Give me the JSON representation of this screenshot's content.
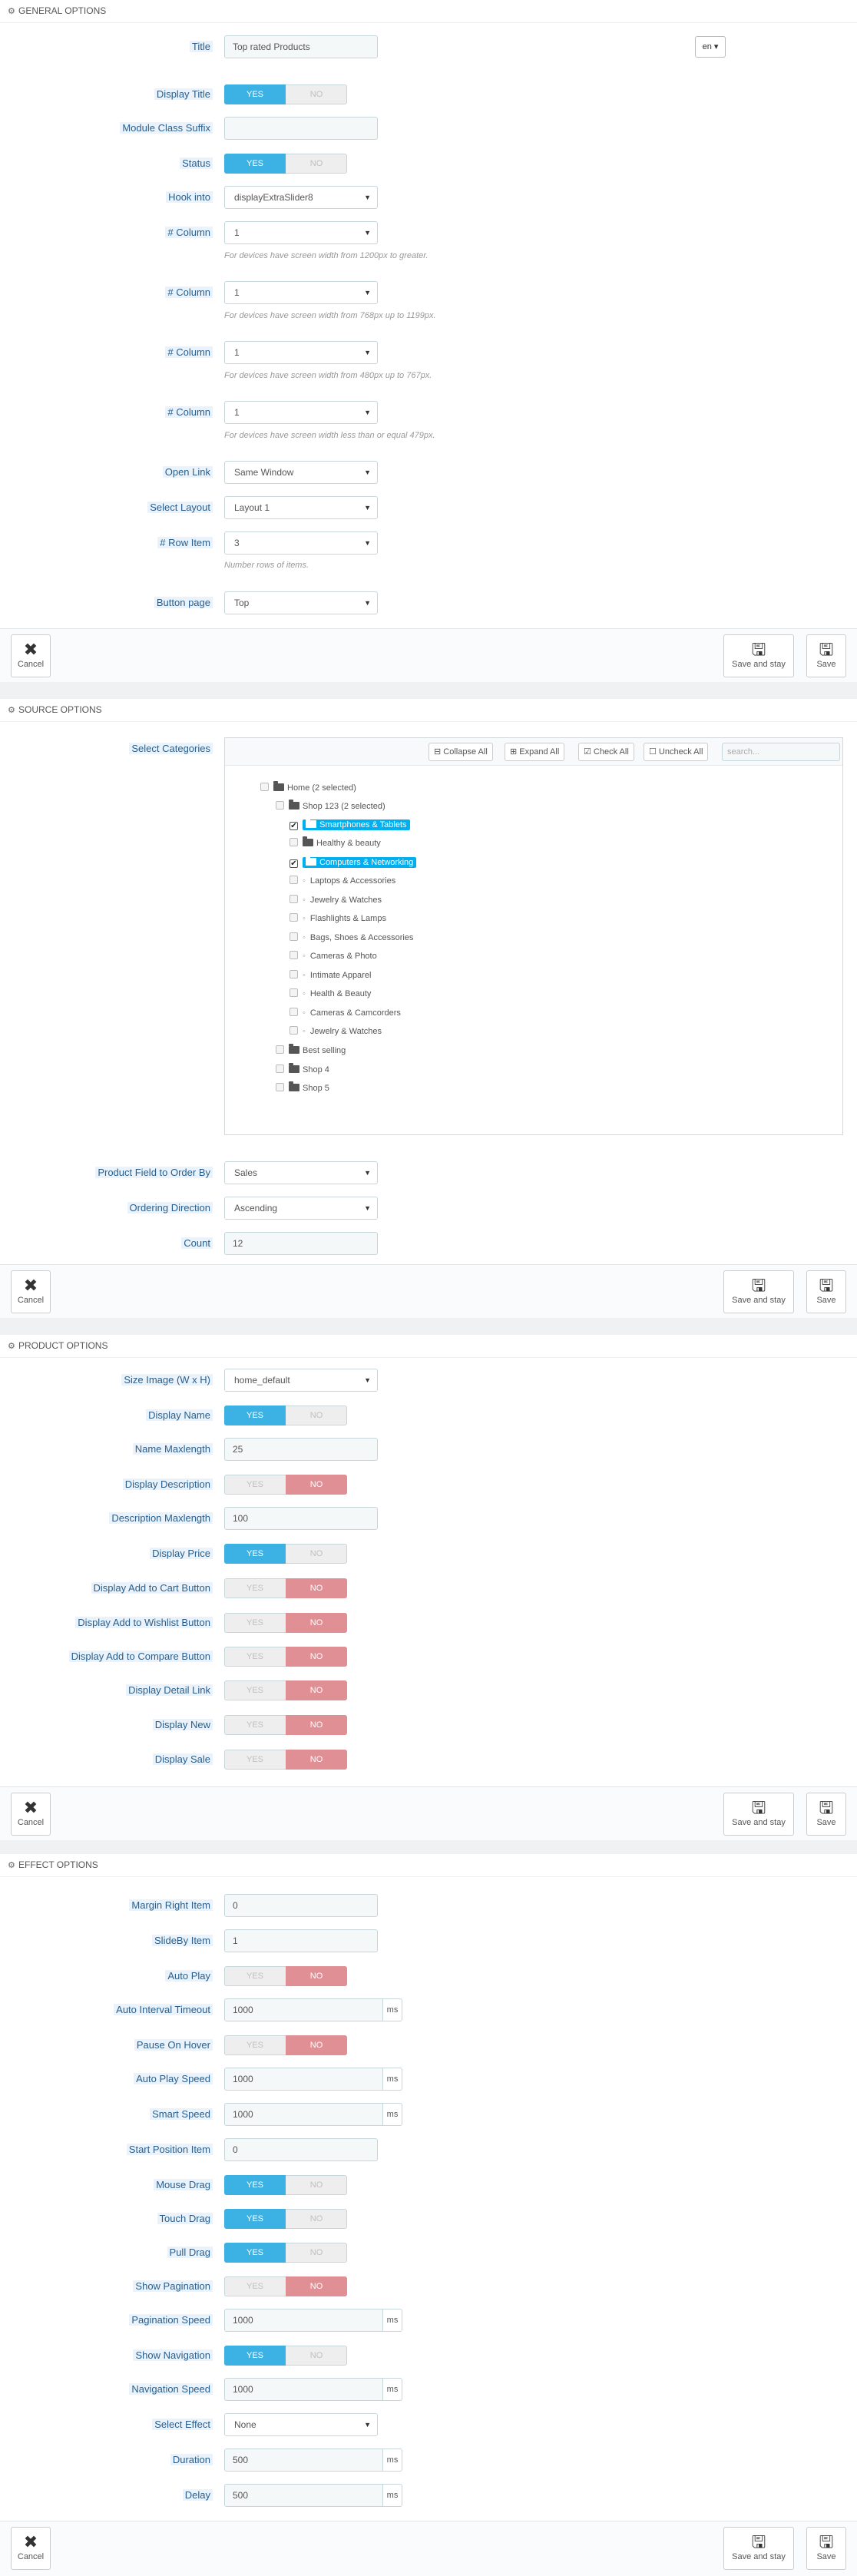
{
  "general": {
    "title": "GENERAL OPTIONS",
    "fields": {
      "title_label": "Title",
      "title_value": "Top rated Products",
      "lang": "en",
      "display_title_label": "Display Title",
      "suffix_label": "Module Class Suffix",
      "status_label": "Status",
      "hook_label": "Hook into",
      "hook_value": "displayExtraSlider8",
      "col1_label": "# Column",
      "col1_value": "1",
      "col1_help": "For devices have screen width from 1200px to greater.",
      "col2_label": "# Column",
      "col2_value": "1",
      "col2_help": "For devices have screen width from 768px up to 1199px.",
      "col3_label": "# Column",
      "col3_value": "1",
      "col3_help": "For devices have screen width from 480px up to 767px.",
      "col4_label": "# Column",
      "col4_value": "1",
      "col4_help": "For devices have screen width less than or equal 479px.",
      "open_link_label": "Open Link",
      "open_link_value": "Same Window",
      "layout_label": "Select Layout",
      "layout_value": "Layout 1",
      "row_item_label": "# Row Item",
      "row_item_value": "3",
      "row_item_help": "Number rows of items.",
      "button_page_label": "Button page",
      "button_page_value": "Top"
    }
  },
  "source": {
    "title": "SOURCE OPTIONS",
    "select_categories_label": "Select Categories",
    "tools": {
      "collapse": "Collapse All",
      "expand": "Expand All",
      "check": "Check All",
      "uncheck": "Uncheck All",
      "search_placeholder": "search..."
    },
    "tree": {
      "home": "Home (2 selected)",
      "shop123": "Shop 123 (2 selected)",
      "smartphones": "Smartphones & Tablets",
      "healthy": "Healthy & beauty",
      "computers": "Computers & Networking",
      "laptops": "Laptops & Accessories",
      "jewelry1": "Jewelry & Watches",
      "flashlights": "Flashlights & Lamps",
      "bags": "Bags, Shoes & Accessories",
      "cameras_photo": "Cameras & Photo",
      "intimate": "Intimate Apparel",
      "health": "Health & Beauty",
      "camcorders": "Cameras & Camcorders",
      "jewelry2": "Jewelry & Watches",
      "best": "Best selling",
      "shop4": "Shop 4",
      "shop5": "Shop 5"
    },
    "order_by_label": "Product Field to Order By",
    "order_by_value": "Sales",
    "direction_label": "Ordering Direction",
    "direction_value": "Ascending",
    "count_label": "Count",
    "count_value": "12"
  },
  "product": {
    "title": "PRODUCT OPTIONS",
    "size_label": "Size Image (W x H)",
    "size_value": "home_default",
    "display_name_label": "Display Name",
    "name_max_label": "Name Maxlength",
    "name_max_value": "25",
    "display_desc_label": "Display Description",
    "desc_max_label": "Description Maxlength",
    "desc_max_value": "100",
    "display_price_label": "Display Price",
    "cart_label": "Display Add to Cart Button",
    "wishlist_label": "Display Add to Wishlist Button",
    "compare_label": "Display Add to Compare Button",
    "detail_label": "Display Detail Link",
    "new_label": "Display New",
    "sale_label": "Display Sale"
  },
  "effect": {
    "title": "EFFECT OPTIONS",
    "margin_label": "Margin Right Item",
    "margin_value": "0",
    "slideby_label": "SlideBy Item",
    "slideby_value": "1",
    "autoplay_label": "Auto Play",
    "interval_label": "Auto Interval Timeout",
    "interval_value": "1000",
    "pause_label": "Pause On Hover",
    "autospeed_label": "Auto Play Speed",
    "autospeed_value": "1000",
    "smart_label": "Smart Speed",
    "smart_value": "1000",
    "start_label": "Start Position Item",
    "start_value": "0",
    "mouse_label": "Mouse Drag",
    "touch_label": "Touch Drag",
    "pull_label": "Pull Drag",
    "showpag_label": "Show Pagination",
    "pagspeed_label": "Pagination Speed",
    "pagspeed_value": "1000",
    "shownav_label": "Show Navigation",
    "navspeed_label": "Navigation Speed",
    "navspeed_value": "1000",
    "effect_label": "Select Effect",
    "effect_value": "None",
    "duration_label": "Duration",
    "duration_value": "500",
    "delay_label": "Delay",
    "delay_value": "500"
  },
  "common": {
    "yes": "YES",
    "no": "NO",
    "ms": "ms",
    "cancel": "Cancel",
    "save_stay": "Save and stay",
    "save": "Save"
  },
  "colors": {
    "accent": "#3bb1e4",
    "no_on": "#e08f95",
    "label": "#2b5e8a",
    "highlight": "#00aff0"
  }
}
